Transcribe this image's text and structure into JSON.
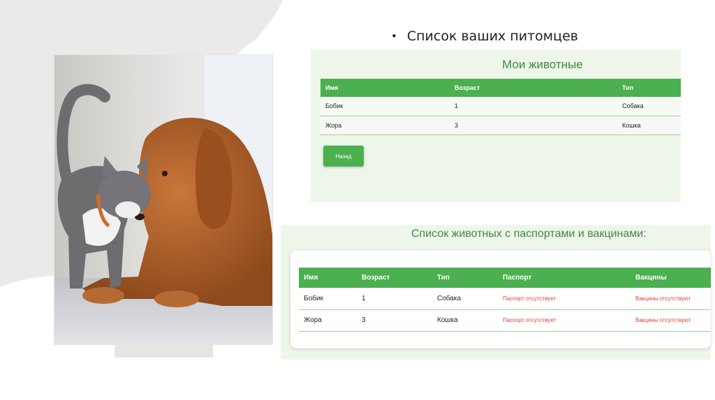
{
  "slide": {
    "bullet": "•",
    "title": "Список ваших питомцев"
  },
  "my_animals": {
    "title": "Мои животные",
    "columns": [
      "Имя",
      "Возраст",
      "Тип"
    ],
    "rows": [
      [
        "Бобик",
        "1",
        "Собака"
      ],
      [
        "Жора",
        "3",
        "Кошка"
      ]
    ],
    "back_button": "Назад"
  },
  "passports": {
    "title": "Список животных с паспортами и вакцинами:",
    "columns": [
      "Имя",
      "Возраст",
      "Тип",
      "Паспорт",
      "Вакцины"
    ],
    "rows": [
      [
        "Бобик",
        "1",
        "Собака",
        "Паспорт отсутствует",
        "Вакцины отсутствуют"
      ],
      [
        "Жора",
        "3",
        "Кошка",
        "Паспорт отсутствует",
        "Вакцины отсутствуют"
      ]
    ]
  },
  "colors": {
    "accent_green": "#4caf50",
    "title_green": "#3d8a3d",
    "panel_bg": "#eef6e9",
    "warning_red": "#e53935"
  }
}
